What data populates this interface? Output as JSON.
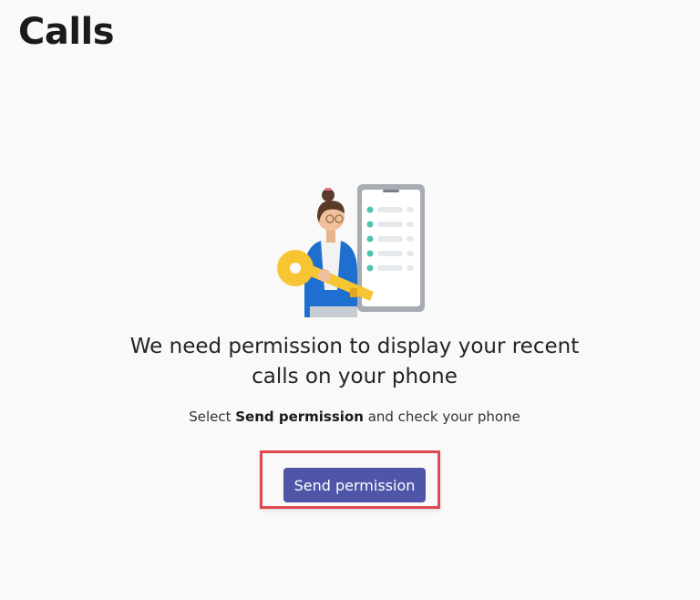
{
  "page": {
    "title": "Calls"
  },
  "illustration": {
    "icon": "person-with-key-and-phone-illustration"
  },
  "message": {
    "headline_line1": "We need permission to display your recent",
    "headline_line2": "calls on your phone",
    "instruction_prefix": "Select ",
    "instruction_bold": "Send permission",
    "instruction_suffix": " and check your phone"
  },
  "actions": {
    "send_permission_label": "Send permission"
  },
  "colors": {
    "button": "#4f56a8",
    "highlight": "#e0484e",
    "background": "#f9f9f9"
  }
}
